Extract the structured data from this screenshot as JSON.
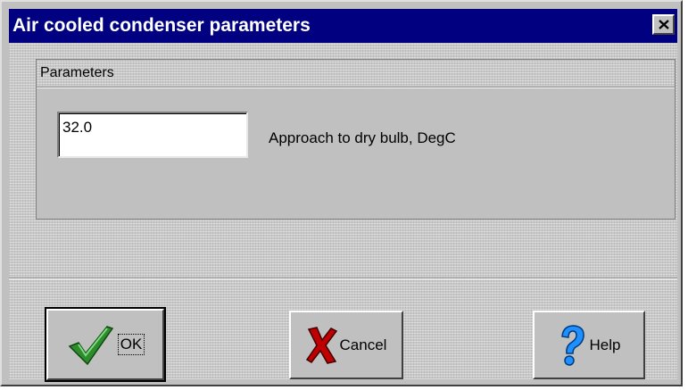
{
  "window": {
    "title": "Air cooled condenser parameters",
    "close_icon": "close-icon"
  },
  "group": {
    "title": "Parameters"
  },
  "fields": {
    "approach_value": "32.0",
    "approach_label": "Approach to dry bulb, DegC"
  },
  "buttons": {
    "ok_label": "OK",
    "ok_icon": "checkmark-icon",
    "cancel_label": "Cancel",
    "cancel_icon": "red-x-icon",
    "help_label": "Help",
    "help_icon": "question-mark-icon"
  },
  "colors": {
    "titlebar": "#000080",
    "face": "#c0c0c0",
    "check": "#2e8b2e",
    "cancel_x": "#c00000",
    "help": "#1e90ff"
  }
}
